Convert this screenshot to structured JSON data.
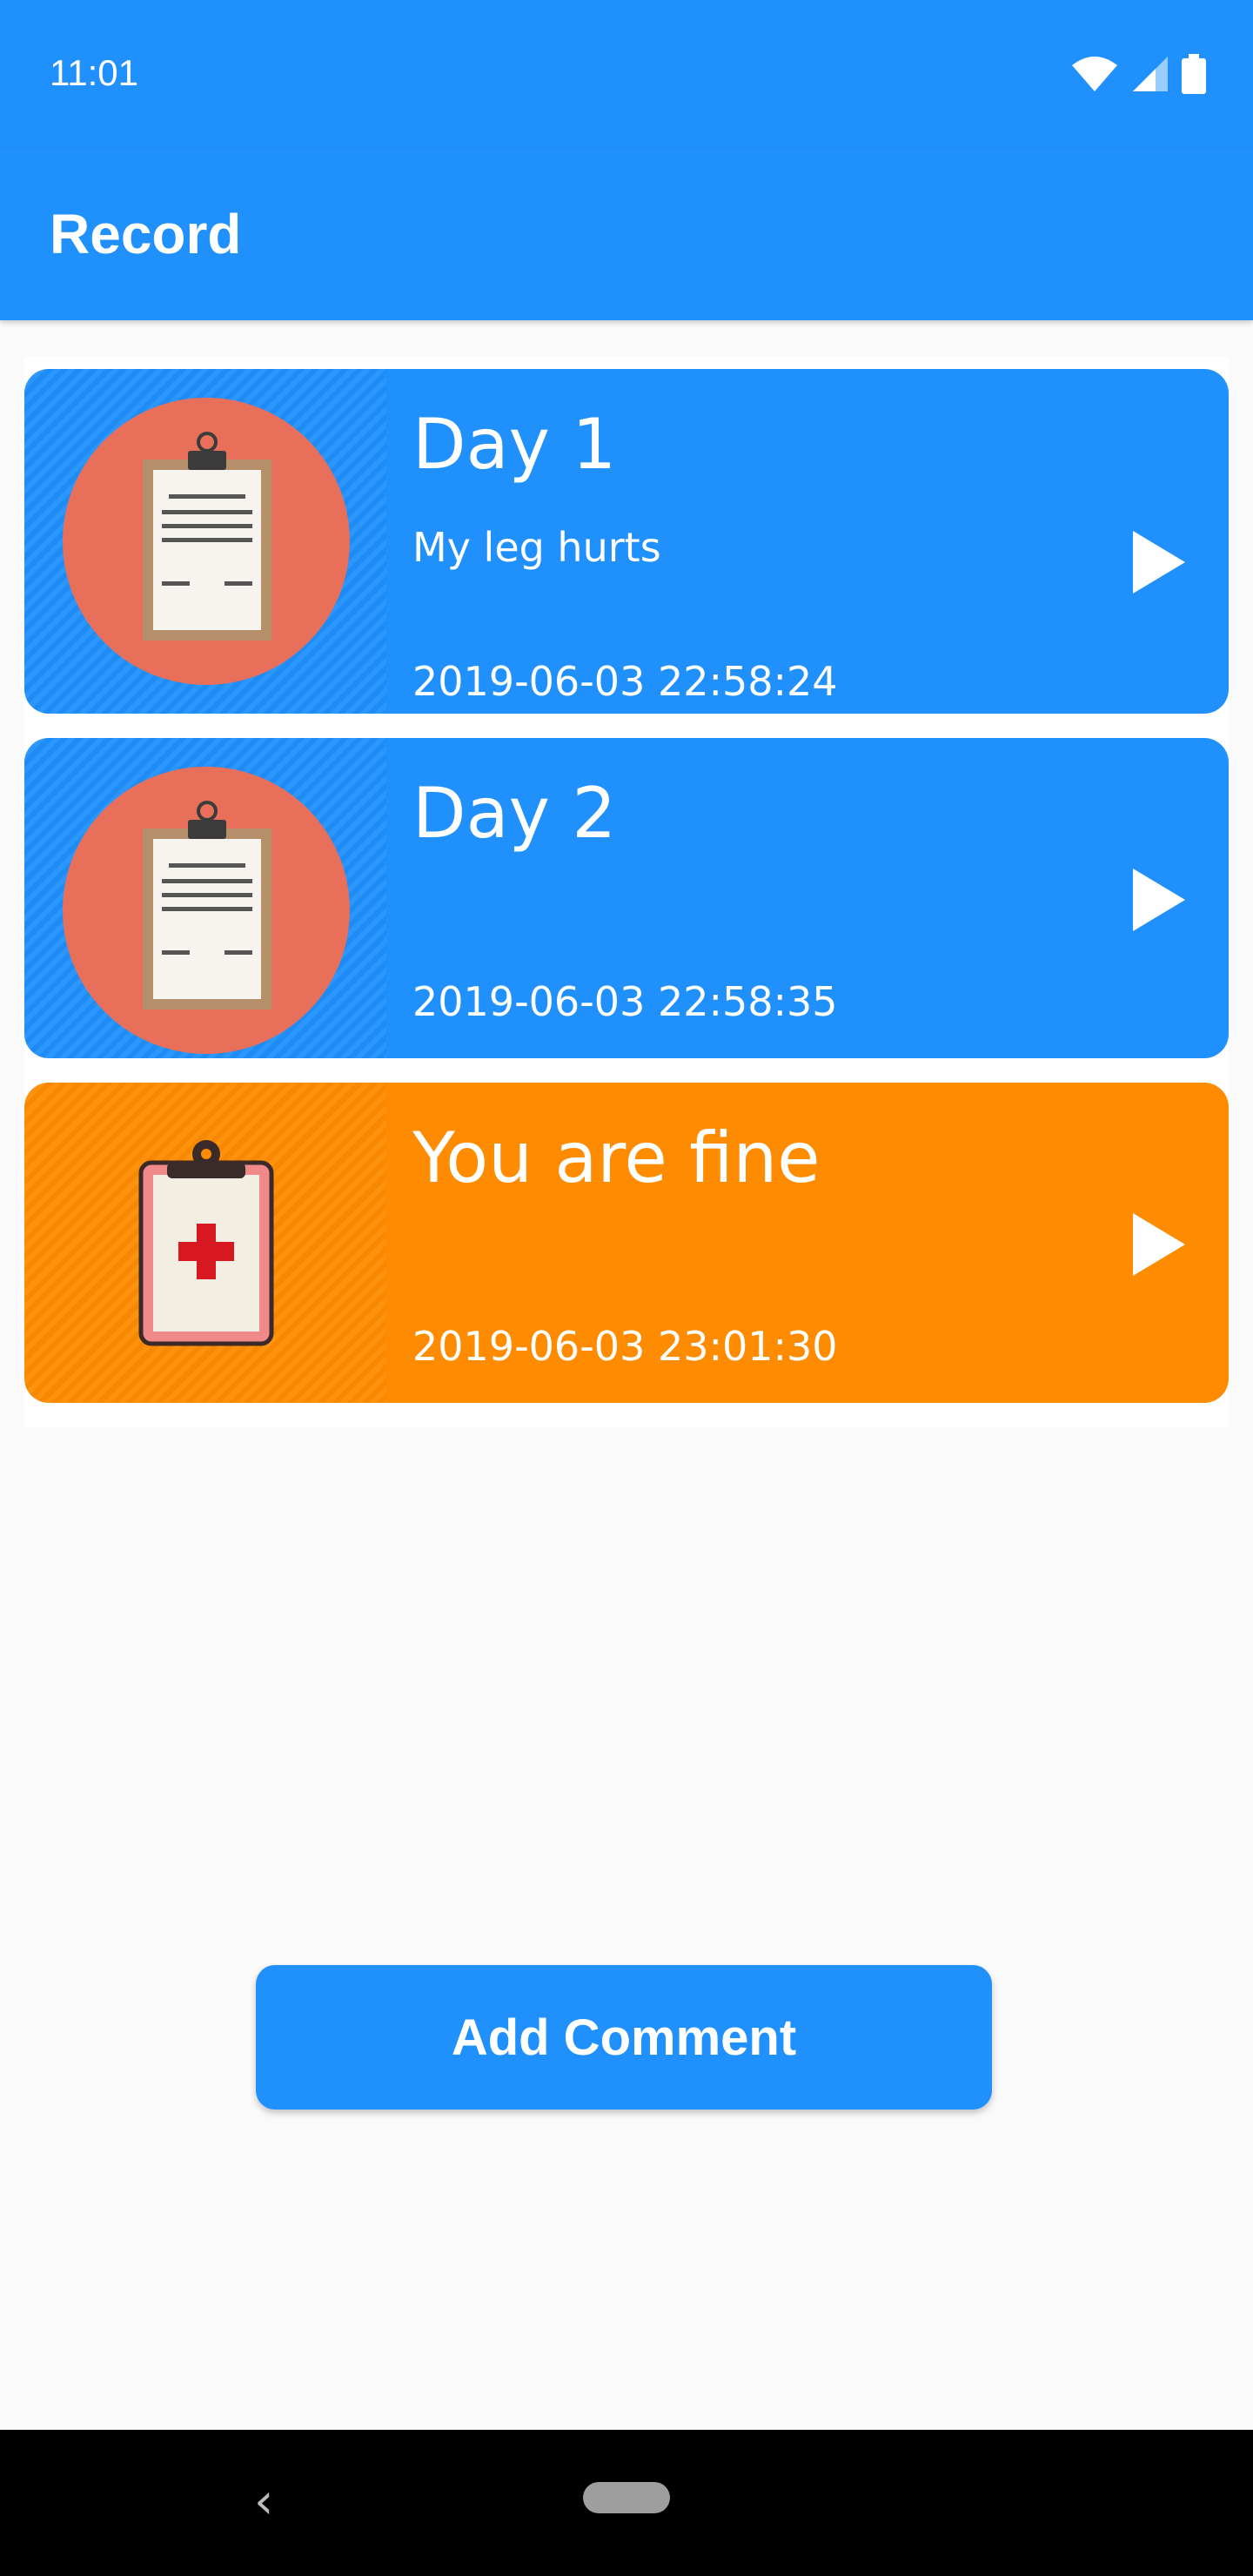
{
  "status": {
    "time": "11:01",
    "icons": [
      "wifi-icon",
      "cellular-signal-icon",
      "battery-icon"
    ]
  },
  "appbar": {
    "title": "Record"
  },
  "records": [
    {
      "title": "Day 1",
      "subtitle": "My leg hurts",
      "date": "2019-06-03 22:58:24",
      "icon": "clipboard-note-icon",
      "color": "#2090fd"
    },
    {
      "title": "Day 2",
      "subtitle": "",
      "date": "2019-06-03 22:58:35",
      "icon": "clipboard-note-icon",
      "color": "#2090fd"
    },
    {
      "title": "You are fine",
      "subtitle": "",
      "date": "2019-06-03 23:01:30",
      "icon": "medical-clipboard-icon",
      "color": "#ff8c00"
    }
  ],
  "actions": {
    "add_comment_label": "Add Comment"
  },
  "colors": {
    "primary": "#2090fd",
    "accent": "#ff8c00",
    "icon_circle": "#e8705a"
  },
  "navbar": {
    "buttons": [
      "back-icon",
      "home-pill-icon"
    ]
  }
}
